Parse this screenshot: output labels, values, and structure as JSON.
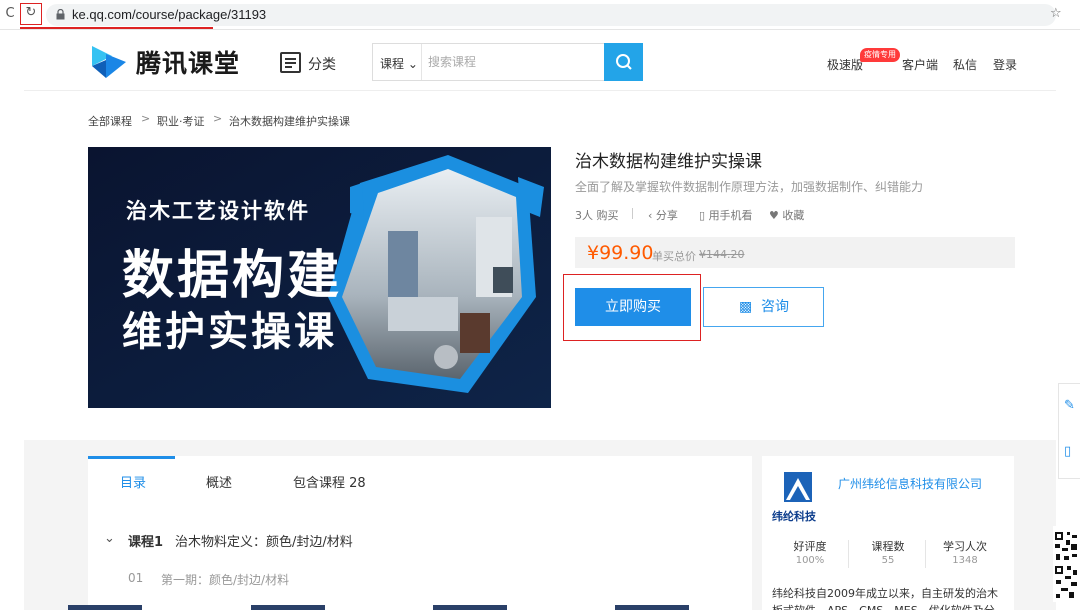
{
  "browser": {
    "url": "ke.qq.com/course/package/31193"
  },
  "header": {
    "logo_text": "腾讯课堂",
    "category_label": "分类",
    "search_type": "课程",
    "search_placeholder": "搜索课程",
    "links": {
      "speed": "极速版",
      "speed_badge": "疫情专用",
      "client": "客户端",
      "messages": "私信",
      "login": "登录"
    }
  },
  "breadcrumb": [
    "全部课程",
    "职业·考证",
    "治木数据构建维护实操课"
  ],
  "cover": {
    "line1": "治木工艺设计软件",
    "line2": "数据构建",
    "line3": "维护实操课"
  },
  "course": {
    "title": "治木数据构建维护实操课",
    "subtitle": "全面了解及掌握软件数据制作原理方法，加强数据制作、纠错能力",
    "buyers": "3人 购买",
    "share": "分享",
    "mobile": "用手机看",
    "favorite": "收藏",
    "price": "¥99.90",
    "price_label": "单买总价",
    "original_price": "¥144.20",
    "buy_label": "立即购买",
    "consult_label": "咨询"
  },
  "tabs": {
    "items": [
      "目录",
      "概述",
      "包含课程 28"
    ],
    "active": 0
  },
  "lessons": {
    "course_label": "课程1",
    "course_title": "治木物料定义：颜色/封边/材料",
    "rows": [
      {
        "index": "01",
        "title": "第一期：颜色/封边/材料"
      }
    ]
  },
  "org": {
    "logo_text": "纬纶科技",
    "name": "广州纬纶信息科技有限公司",
    "stats": [
      {
        "label": "好评度",
        "value": "100%"
      },
      {
        "label": "课程数",
        "value": "55"
      },
      {
        "label": "学习人次",
        "value": "1348"
      }
    ],
    "description": "纬纶科技自2009年成立以来，自主研发的治木板式软件、APS、CMS、MES，优化软件及分"
  },
  "colors": {
    "accent": "#1f8ee8",
    "search_button": "#23a4e8",
    "price": "#ff5a00",
    "highlight_box": "#dd2222",
    "cover_bg": "#0b1730"
  }
}
